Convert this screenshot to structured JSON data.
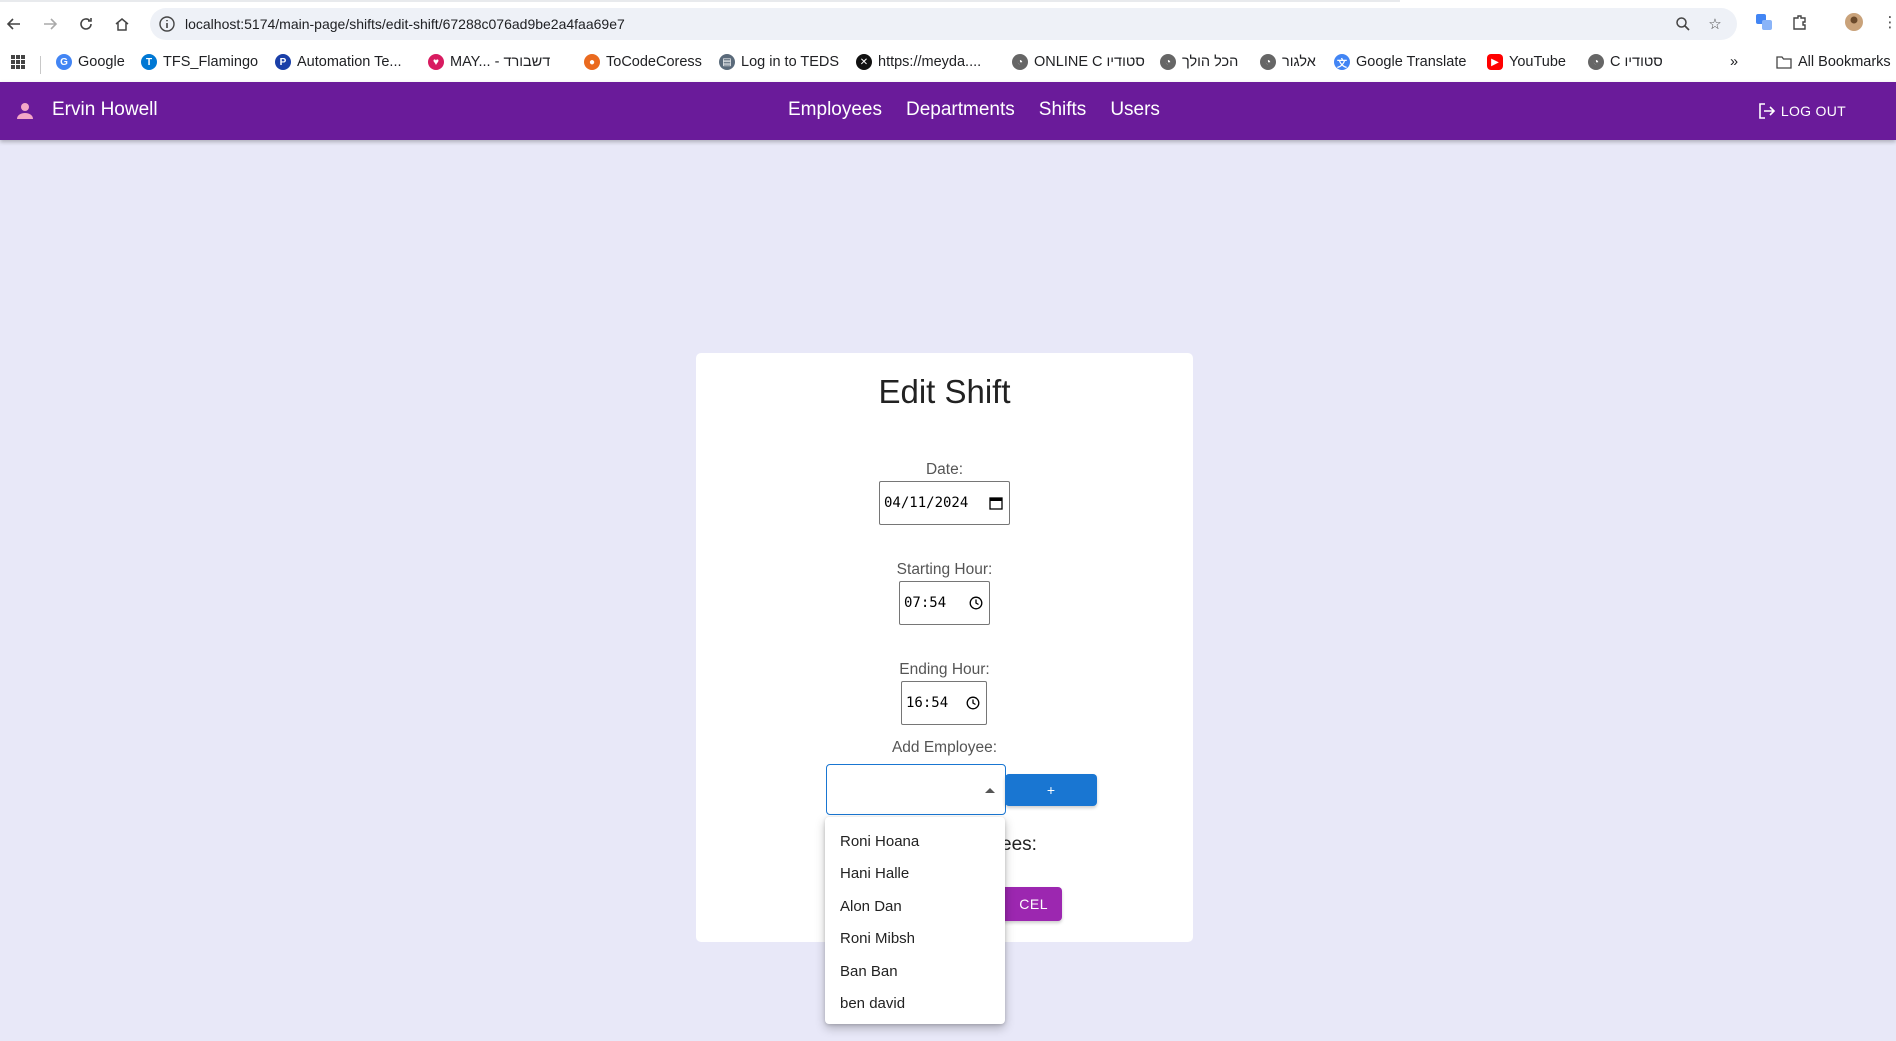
{
  "browser": {
    "url": "localhost:5174/main-page/shifts/edit-shift/67288c076ad9be2a4faa69e7",
    "bookmarks": [
      {
        "label": "Google",
        "color": "#4285f4",
        "glyph": "G"
      },
      {
        "label": "TFS_Flamingo",
        "color": "#0078d4",
        "glyph": "T"
      },
      {
        "label": "Automation Te...",
        "color": "#1a3fa8",
        "glyph": "P"
      },
      {
        "label": "MAY... - דשבורד",
        "color": "#d81b60",
        "glyph": "♥"
      },
      {
        "label": "ToCodeCoress",
        "color": "#ea6a1f",
        "glyph": "●"
      },
      {
        "label": "Log in to TEDS",
        "color": "#5a6a7a",
        "glyph": "▤"
      },
      {
        "label": "https://meyda....",
        "color": "#111111",
        "glyph": "✕"
      },
      {
        "label": "ONLINE C סטודיו",
        "color": "#666666",
        "glyph": "◔"
      },
      {
        "label": "הכל הולך",
        "color": "#666666",
        "glyph": "◔"
      },
      {
        "label": "אלגור",
        "color": "#666666",
        "glyph": "◔"
      },
      {
        "label": "Google Translate",
        "color": "#4285f4",
        "glyph": "文"
      },
      {
        "label": "YouTube",
        "color": "#ff0000",
        "glyph": "▶"
      },
      {
        "label": "C סטודיו",
        "color": "#666666",
        "glyph": "◔"
      }
    ],
    "all_bookmarks": "All Bookmarks",
    "more": "»"
  },
  "appbar": {
    "user_name": "Ervin Howell",
    "nav": [
      "Employees",
      "Departments",
      "Shifts",
      "Users"
    ],
    "logout": "LOG OUT",
    "color": "#6a1b9a"
  },
  "form": {
    "title": "Edit Shift",
    "date_label": "Date:",
    "date_value": "04/11/2024",
    "start_label": "Starting Hour:",
    "start_value": "07:54",
    "end_label": "Ending Hour:",
    "end_value": "16:54",
    "add_employee_label": "Add Employee:",
    "add_button": "+",
    "employees_label_visible": "ees:",
    "cancel_visible": "CEL"
  },
  "dropdown": {
    "options": [
      "Roni Hoana",
      "Hani Halle",
      "Alon Dan",
      "Roni Mibsh",
      "Ban Ban",
      "ben david"
    ]
  }
}
